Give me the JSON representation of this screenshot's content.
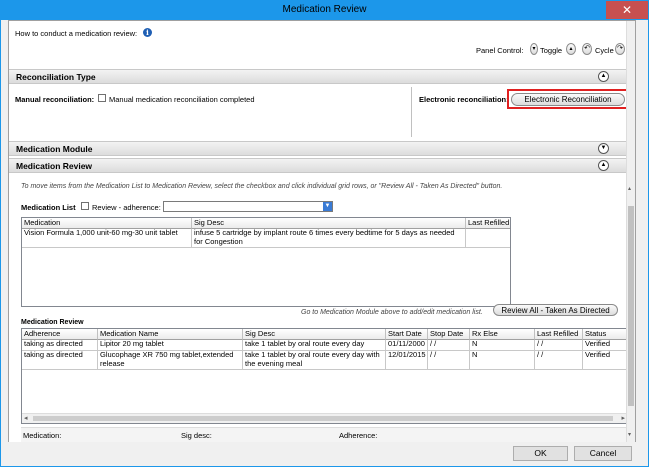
{
  "window": {
    "title": "Medication Review",
    "close": "✕"
  },
  "howto": {
    "label": "How to conduct a medication review:"
  },
  "panel_control": {
    "label": "Panel Control:",
    "toggle": "Toggle",
    "cycle": "Cycle"
  },
  "reconciliation": {
    "title": "Reconciliation Type",
    "manual_label": "Manual reconciliation:",
    "manual_checkbox": "Manual medication reconciliation completed",
    "electronic_label": "Electronic reconciliation:",
    "electronic_button": "Electronic Reconciliation"
  },
  "medication_module": {
    "title": "Medication Module"
  },
  "medication_review_section": {
    "title": "Medication Review",
    "instructions": "To move items from the Medication List to Medication Review, select the checkbox and click individual grid rows, or \"Review All - Taken As Directed\" button."
  },
  "medication_list": {
    "label": "Medication List",
    "adherence_checkbox": "Review - adherence:",
    "columns": [
      "Medication",
      "Sig Desc",
      "Last Refilled"
    ],
    "rows": [
      {
        "medication": "Vision Formula 1,000 unit-60 mg-30 unit tablet",
        "sig": "infuse 5 cartridge by implant route 6 times every bedtime for 5 days as needed for Congestion",
        "refilled": ""
      }
    ]
  },
  "review": {
    "label": "Medication Review",
    "hint": "Go to Medication Module above to add/edit medication list.",
    "review_all_button": "Review All - Taken As Directed",
    "columns": [
      "Adherence",
      "Medication Name",
      "Sig Desc",
      "Start Date",
      "Stop Date",
      "Rx Else",
      "Last Refilled",
      "Status"
    ],
    "rows": [
      {
        "adherence": "taking as directed",
        "name": "Lipitor 20 mg tablet",
        "sig": "take 1 tablet by oral route  every day",
        "start": "01/11/2000",
        "stop": "/ /",
        "rx": "N",
        "refilled": "/ /",
        "status": "Verified"
      },
      {
        "adherence": "taking as directed",
        "name": "Glucophage XR 750 mg tablet,extended release",
        "sig": "take 1 tablet by oral route  every day with the evening meal",
        "start": "12/01/2015",
        "stop": "/ /",
        "rx": "N",
        "refilled": "/ /",
        "status": "Verified"
      }
    ]
  },
  "detail": {
    "medication": "Medication:",
    "sig": "Sig desc:",
    "adherence": "Adherence:"
  },
  "buttons": {
    "ok": "OK",
    "cancel": "Cancel"
  }
}
